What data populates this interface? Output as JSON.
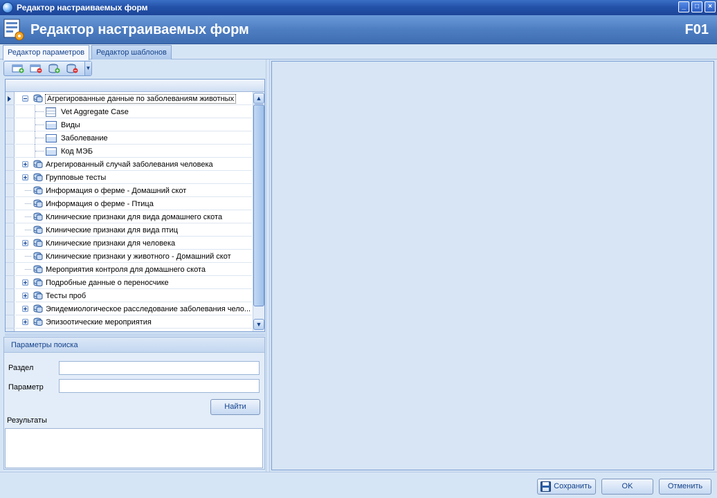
{
  "window": {
    "title": "Редактор настраиваемых форм"
  },
  "header": {
    "title": "Редактор настраиваемых форм",
    "code": "F01"
  },
  "tabs": [
    {
      "label": "Редактор параметров",
      "active": true
    },
    {
      "label": "Редактор шаблонов",
      "active": false
    }
  ],
  "toolbar": {
    "buttons": [
      {
        "icon": "add-form-icon"
      },
      {
        "icon": "delete-form-icon"
      },
      {
        "icon": "add-parameter-icon"
      },
      {
        "icon": "delete-parameter-icon"
      }
    ]
  },
  "tree": {
    "rows": [
      {
        "label": "Агрегированные данные по заболеваниям животных",
        "level": 0,
        "expander": "minus",
        "icon": "database-icon",
        "selected": true
      },
      {
        "label": "Vet Aggregate Case",
        "level": 1,
        "icon": "grid-icon"
      },
      {
        "label": "Виды",
        "level": 1,
        "icon": "form-icon"
      },
      {
        "label": "Заболевание",
        "level": 1,
        "icon": "form-icon"
      },
      {
        "label": "Код МЭБ",
        "level": 1,
        "icon": "form-icon"
      },
      {
        "label": "Агрегированный случай заболевания человека",
        "level": 0,
        "expander": "plus",
        "icon": "database-icon"
      },
      {
        "label": "Групповые тесты",
        "level": 0,
        "expander": "plus",
        "icon": "database-icon"
      },
      {
        "label": "Информация о ферме - Домашний скот",
        "level": 0,
        "expander": "none",
        "icon": "database-icon"
      },
      {
        "label": "Информация о ферме - Птица",
        "level": 0,
        "expander": "none",
        "icon": "database-icon"
      },
      {
        "label": "Клинические признаки для вида домашнего скота",
        "level": 0,
        "expander": "none",
        "icon": "database-icon"
      },
      {
        "label": "Клинические признаки для вида птиц",
        "level": 0,
        "expander": "none",
        "icon": "database-icon"
      },
      {
        "label": "Клинические признаки для человека",
        "level": 0,
        "expander": "plus",
        "icon": "database-icon"
      },
      {
        "label": "Клинические признаки у животного - Домашний скот",
        "level": 0,
        "expander": "none",
        "icon": "database-icon"
      },
      {
        "label": "Мероприятия контроля для домашнего скота",
        "level": 0,
        "expander": "none",
        "icon": "database-icon"
      },
      {
        "label": "Подробные данные о переносчике",
        "level": 0,
        "expander": "plus",
        "icon": "database-icon"
      },
      {
        "label": "Тесты проб",
        "level": 0,
        "expander": "plus",
        "icon": "database-icon"
      },
      {
        "label": "Эпидемиологическое расследование заболевания чело...",
        "level": 0,
        "expander": "plus",
        "icon": "database-icon"
      },
      {
        "label": "Эпизоотические мероприятия",
        "level": 0,
        "expander": "plus",
        "icon": "database-icon"
      }
    ]
  },
  "search": {
    "title": "Параметры поиска",
    "section_label": "Раздел",
    "section_value": "",
    "parameter_label": "Параметр",
    "parameter_value": "",
    "find_label": "Найти",
    "results_label": "Результаты"
  },
  "footer": {
    "save_label": "Сохранить",
    "ok_label": "OK",
    "cancel_label": "Отменить"
  }
}
